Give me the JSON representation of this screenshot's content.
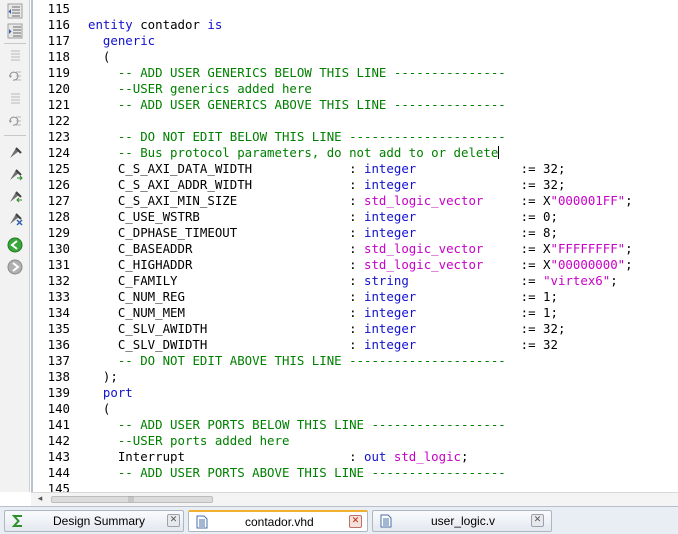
{
  "editor": {
    "lines": [
      {
        "n": "115",
        "parts": []
      },
      {
        "n": "116",
        "parts": [
          [
            "kw",
            "entity"
          ],
          [
            "t",
            " contador "
          ],
          [
            "kw",
            "is"
          ]
        ]
      },
      {
        "n": "117",
        "parts": [
          [
            "t",
            "  "
          ],
          [
            "kw",
            "generic"
          ]
        ]
      },
      {
        "n": "118",
        "parts": [
          [
            "t",
            "  ("
          ]
        ]
      },
      {
        "n": "119",
        "parts": [
          [
            "t",
            "    "
          ],
          [
            "cm",
            "-- ADD USER GENERICS BELOW THIS LINE ---------------"
          ]
        ]
      },
      {
        "n": "120",
        "parts": [
          [
            "t",
            "    "
          ],
          [
            "cm",
            "--USER generics added here"
          ]
        ]
      },
      {
        "n": "121",
        "parts": [
          [
            "t",
            "    "
          ],
          [
            "cm",
            "-- ADD USER GENERICS ABOVE THIS LINE ---------------"
          ]
        ]
      },
      {
        "n": "122",
        "parts": []
      },
      {
        "n": "123",
        "parts": [
          [
            "t",
            "    "
          ],
          [
            "cm",
            "-- DO NOT EDIT BELOW THIS LINE ---------------------"
          ]
        ]
      },
      {
        "n": "124",
        "parts": [
          [
            "t",
            "    "
          ],
          [
            "cm",
            "-- Bus protocol parameters, do not add to or delete"
          ],
          [
            "caret",
            ""
          ]
        ]
      },
      {
        "n": "125",
        "parts": [
          [
            "t",
            "    C_S_AXI_DATA_WIDTH             : "
          ],
          [
            "kw",
            "integer"
          ],
          [
            "t",
            "              := 32;"
          ]
        ]
      },
      {
        "n": "126",
        "parts": [
          [
            "t",
            "    C_S_AXI_ADDR_WIDTH             : "
          ],
          [
            "kw",
            "integer"
          ],
          [
            "t",
            "              := 32;"
          ]
        ]
      },
      {
        "n": "127",
        "parts": [
          [
            "t",
            "    C_S_AXI_MIN_SIZE               : "
          ],
          [
            "ty",
            "std_logic_vector"
          ],
          [
            "t",
            "     := X"
          ],
          [
            "ty",
            "\"000001FF\""
          ],
          [
            "t",
            ";"
          ]
        ]
      },
      {
        "n": "128",
        "parts": [
          [
            "t",
            "    C_USE_WSTRB                    : "
          ],
          [
            "kw",
            "integer"
          ],
          [
            "t",
            "              := 0;"
          ]
        ]
      },
      {
        "n": "129",
        "parts": [
          [
            "t",
            "    C_DPHASE_TIMEOUT               : "
          ],
          [
            "kw",
            "integer"
          ],
          [
            "t",
            "              := 8;"
          ]
        ]
      },
      {
        "n": "130",
        "parts": [
          [
            "t",
            "    C_BASEADDR                     : "
          ],
          [
            "ty",
            "std_logic_vector"
          ],
          [
            "t",
            "     := X"
          ],
          [
            "ty",
            "\"FFFFFFFF\""
          ],
          [
            "t",
            ";"
          ]
        ]
      },
      {
        "n": "131",
        "parts": [
          [
            "t",
            "    C_HIGHADDR                     : "
          ],
          [
            "ty",
            "std_logic_vector"
          ],
          [
            "t",
            "     := X"
          ],
          [
            "ty",
            "\"00000000\""
          ],
          [
            "t",
            ";"
          ]
        ]
      },
      {
        "n": "132",
        "parts": [
          [
            "t",
            "    C_FAMILY                       : "
          ],
          [
            "kw",
            "string"
          ],
          [
            "t",
            "               := "
          ],
          [
            "ty",
            "\"virtex6\""
          ],
          [
            "t",
            ";"
          ]
        ]
      },
      {
        "n": "133",
        "parts": [
          [
            "t",
            "    C_NUM_REG                      : "
          ],
          [
            "kw",
            "integer"
          ],
          [
            "t",
            "              := 1;"
          ]
        ]
      },
      {
        "n": "134",
        "parts": [
          [
            "t",
            "    C_NUM_MEM                      : "
          ],
          [
            "kw",
            "integer"
          ],
          [
            "t",
            "              := 1;"
          ]
        ]
      },
      {
        "n": "135",
        "parts": [
          [
            "t",
            "    C_SLV_AWIDTH                   : "
          ],
          [
            "kw",
            "integer"
          ],
          [
            "t",
            "              := 32;"
          ]
        ]
      },
      {
        "n": "136",
        "parts": [
          [
            "t",
            "    C_SLV_DWIDTH                   : "
          ],
          [
            "kw",
            "integer"
          ],
          [
            "t",
            "              := 32"
          ]
        ]
      },
      {
        "n": "137",
        "parts": [
          [
            "t",
            "    "
          ],
          [
            "cm",
            "-- DO NOT EDIT ABOVE THIS LINE ---------------------"
          ]
        ]
      },
      {
        "n": "138",
        "parts": [
          [
            "t",
            "  );"
          ]
        ]
      },
      {
        "n": "139",
        "parts": [
          [
            "t",
            "  "
          ],
          [
            "kw",
            "port"
          ]
        ]
      },
      {
        "n": "140",
        "parts": [
          [
            "t",
            "  ("
          ]
        ]
      },
      {
        "n": "141",
        "parts": [
          [
            "t",
            "    "
          ],
          [
            "cm",
            "-- ADD USER PORTS BELOW THIS LINE ------------------"
          ]
        ]
      },
      {
        "n": "142",
        "parts": [
          [
            "t",
            "    "
          ],
          [
            "cm",
            "--USER ports added here"
          ]
        ]
      },
      {
        "n": "143",
        "parts": [
          [
            "t",
            "    Interrupt                      : "
          ],
          [
            "kw",
            "out"
          ],
          [
            "t",
            " "
          ],
          [
            "ty",
            "std_logic"
          ],
          [
            "t",
            ";"
          ]
        ]
      },
      {
        "n": "144",
        "parts": [
          [
            "t",
            "    "
          ],
          [
            "cm",
            "-- ADD USER PORTS ABOVE THIS LINE ------------------"
          ]
        ]
      },
      {
        "n": "145",
        "parts": []
      }
    ]
  },
  "toolbar": {
    "icons": [
      "unindent-icon",
      "indent-icon",
      "comment-icon",
      "uncomment-icon",
      "block-comment-icon",
      "block-uncomment-icon",
      "bookmark-toggle-icon",
      "bookmark-next-icon",
      "bookmark-prev-icon",
      "bookmark-clear-icon",
      "go-back-icon",
      "go-forward-icon"
    ]
  },
  "hscroll": {
    "left_arrow": "◂",
    "grip": "|||"
  },
  "tabs": [
    {
      "label": "Design Summary",
      "icon": "sigma-icon",
      "close": "✕",
      "active": false
    },
    {
      "label": "contador.vhd",
      "icon": "document-icon",
      "close": "✕",
      "active": true
    },
    {
      "label": "user_logic.v",
      "icon": "document-icon",
      "close": "✕",
      "active": false
    }
  ],
  "colors": {
    "keyword": "#1010d0",
    "type": "#c800c8",
    "comment": "#008000"
  }
}
